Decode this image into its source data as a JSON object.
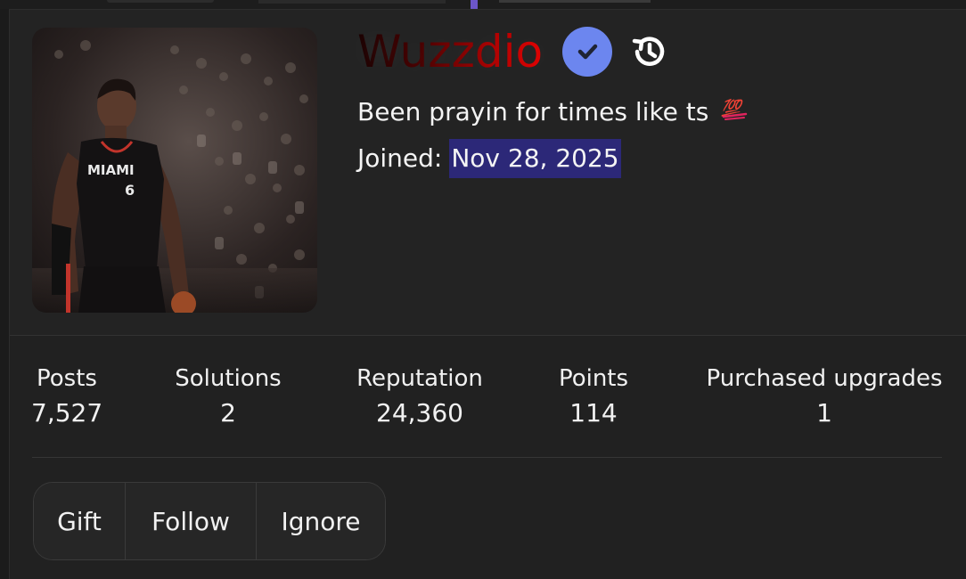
{
  "profile": {
    "username": "Wuzzdio",
    "username_gradient": [
      "#1a0000",
      "#e00000"
    ],
    "verified_color": "#6c86ef",
    "bio": "Been prayin for times like ts",
    "bio_emoji": "💯",
    "joined_label": "Joined:",
    "joined_date": "Nov 28, 2025",
    "avatar_jersey_text": "MIAMI",
    "avatar_jersey_number": "6"
  },
  "stats": [
    {
      "label": "Posts",
      "value": "7,527"
    },
    {
      "label": "Solutions",
      "value": "2"
    },
    {
      "label": "Reputation",
      "value": "24,360"
    },
    {
      "label": "Points",
      "value": "114"
    },
    {
      "label": "Purchased upgrades",
      "value": "1"
    }
  ],
  "actions": {
    "gift": "Gift",
    "follow": "Follow",
    "ignore": "Ignore"
  },
  "icons": {
    "verified": "check-badge-icon",
    "history": "history-icon"
  },
  "colors": {
    "background": "#1b1b1b",
    "card": "#212121",
    "highlight": "#2c2878"
  }
}
